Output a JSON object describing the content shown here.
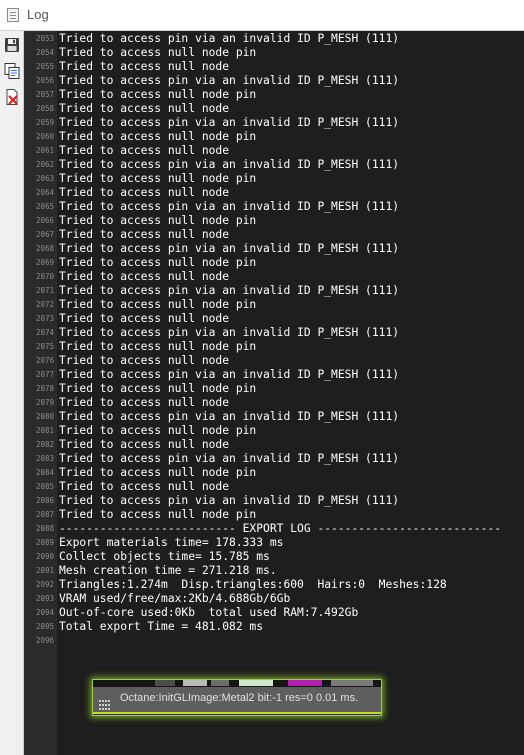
{
  "window": {
    "title": "Log",
    "icon": "log-window-icon"
  },
  "toolbar": {
    "buttons": [
      {
        "name": "save-icon"
      },
      {
        "name": "copy-icon"
      },
      {
        "name": "clear-icon"
      }
    ]
  },
  "log": {
    "lines": [
      {
        "num": "2053",
        "text": "Tried to access pin via an invalid ID P_MESH (111)"
      },
      {
        "num": "2054",
        "text": "Tried to access null node pin"
      },
      {
        "num": "2055",
        "text": "Tried to access null node"
      },
      {
        "num": "2056",
        "text": "Tried to access pin via an invalid ID P_MESH (111)"
      },
      {
        "num": "2057",
        "text": "Tried to access null node pin"
      },
      {
        "num": "2058",
        "text": "Tried to access null node"
      },
      {
        "num": "2059",
        "text": "Tried to access pin via an invalid ID P_MESH (111)"
      },
      {
        "num": "2060",
        "text": "Tried to access null node pin"
      },
      {
        "num": "2061",
        "text": "Tried to access null node"
      },
      {
        "num": "2062",
        "text": "Tried to access pin via an invalid ID P_MESH (111)"
      },
      {
        "num": "2063",
        "text": "Tried to access null node pin"
      },
      {
        "num": "2064",
        "text": "Tried to access null node"
      },
      {
        "num": "2065",
        "text": "Tried to access pin via an invalid ID P_MESH (111)"
      },
      {
        "num": "2066",
        "text": "Tried to access null node pin"
      },
      {
        "num": "2067",
        "text": "Tried to access null node"
      },
      {
        "num": "2068",
        "text": "Tried to access pin via an invalid ID P_MESH (111)"
      },
      {
        "num": "2069",
        "text": "Tried to access null node pin"
      },
      {
        "num": "2070",
        "text": "Tried to access null node"
      },
      {
        "num": "2071",
        "text": "Tried to access pin via an invalid ID P_MESH (111)"
      },
      {
        "num": "2072",
        "text": "Tried to access null node pin"
      },
      {
        "num": "2073",
        "text": "Tried to access null node"
      },
      {
        "num": "2074",
        "text": "Tried to access pin via an invalid ID P_MESH (111)"
      },
      {
        "num": "2075",
        "text": "Tried to access null node pin"
      },
      {
        "num": "2076",
        "text": "Tried to access null node"
      },
      {
        "num": "2077",
        "text": "Tried to access pin via an invalid ID P_MESH (111)"
      },
      {
        "num": "2078",
        "text": "Tried to access null node pin"
      },
      {
        "num": "2079",
        "text": "Tried to access null node"
      },
      {
        "num": "2080",
        "text": "Tried to access pin via an invalid ID P_MESH (111)"
      },
      {
        "num": "2081",
        "text": "Tried to access null node pin"
      },
      {
        "num": "2082",
        "text": "Tried to access null node"
      },
      {
        "num": "2083",
        "text": "Tried to access pin via an invalid ID P_MESH (111)"
      },
      {
        "num": "2084",
        "text": "Tried to access null node pin"
      },
      {
        "num": "2085",
        "text": "Tried to access null node"
      },
      {
        "num": "2086",
        "text": "Tried to access pin via an invalid ID P_MESH (111)"
      },
      {
        "num": "2087",
        "text": "Tried to access null node pin"
      },
      {
        "num": "2088",
        "text": "-------------------------- EXPORT LOG ---------------------------"
      },
      {
        "num": "2089",
        "text": "Export materials time= 178.333 ms"
      },
      {
        "num": "2090",
        "text": "Collect objects time= 15.785 ms"
      },
      {
        "num": "2091",
        "text": "Mesh creation time = 271.218 ms."
      },
      {
        "num": "2092",
        "text": "Triangles:1.274m  Disp.triangles:600  Hairs:0  Meshes:128"
      },
      {
        "num": "2093",
        "text": "VRAM used/free/max:2Kb/4.688Gb/6Gb"
      },
      {
        "num": "2094",
        "text": "Out-of-core used:0Kb  total used RAM:7.492Gb"
      },
      {
        "num": "2095",
        "text": "Total export Time = 481.082 ms"
      },
      {
        "num": "2096",
        "text": ""
      }
    ]
  },
  "popup": {
    "text": "Octane:InitGLImage:Metal2  bit:-1 res=0  0.01 ms.",
    "grip_icon": "grip-icon",
    "accent_color": "#c3d82f"
  }
}
